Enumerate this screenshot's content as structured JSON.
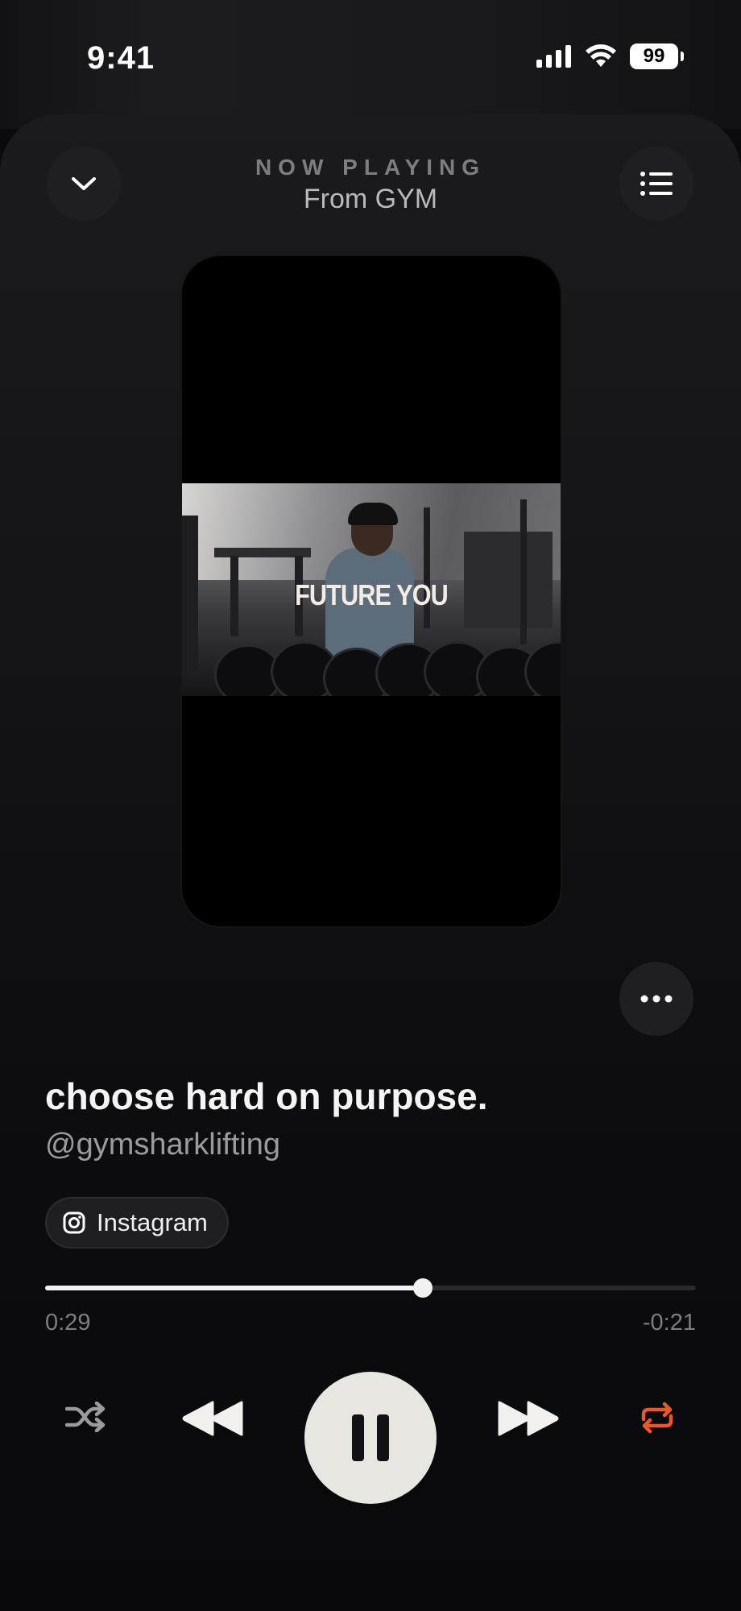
{
  "status_bar": {
    "time": "9:41",
    "battery": "99"
  },
  "header": {
    "kicker": "NOW PLAYING",
    "source": "From GYM"
  },
  "media": {
    "overlay_text": "FUTURE YOU"
  },
  "track": {
    "title": "choose hard on purpose.",
    "artist": "@gymsharklifting"
  },
  "source_chip": {
    "label": "Instagram",
    "icon": "instagram-icon"
  },
  "playback": {
    "elapsed": "0:29",
    "remaining": "-0:21",
    "progress_fraction": 0.58,
    "state": "playing"
  },
  "controls": {
    "shuffle_icon": "shuffle-icon",
    "previous_icon": "rewind-icon",
    "play_pause_icon": "pause-icon",
    "next_icon": "fast-forward-icon",
    "repeat_icon": "repeat-icon",
    "repeat_active_color": "#e8582a"
  },
  "colors": {
    "background": "#0b0b0e",
    "accent": "#e8582a"
  }
}
